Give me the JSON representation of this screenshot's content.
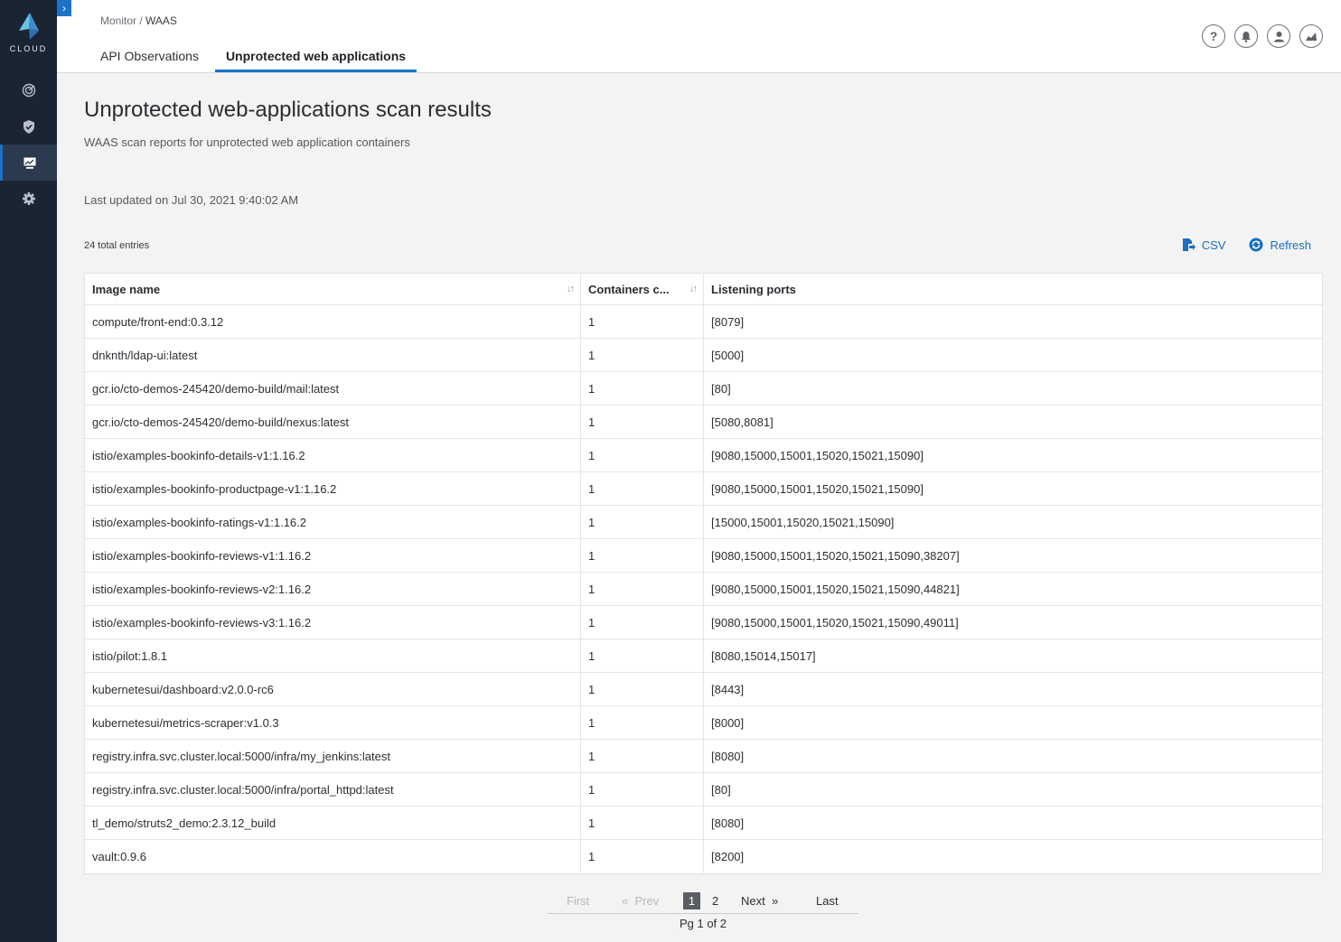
{
  "sidebar": {
    "logo_text": "CLOUD",
    "nav": [
      {
        "icon": "radar-icon"
      },
      {
        "icon": "shield-icon"
      },
      {
        "icon": "monitor-icon",
        "active": true
      },
      {
        "icon": "gear-icon"
      }
    ]
  },
  "header": {
    "breadcrumb_parent": "Monitor",
    "breadcrumb_separator": "/",
    "breadcrumb_current": "WAAS",
    "tabs": [
      {
        "label": "API Observations"
      },
      {
        "label": "Unprotected web applications",
        "active": true
      }
    ],
    "icons": [
      "help-icon",
      "alert-icon",
      "user-icon",
      "analytics-icon"
    ]
  },
  "main": {
    "title": "Unprotected web-applications scan results",
    "subtitle": "WAAS scan reports for unprotected web application containers",
    "last_updated": "Last updated on Jul 30, 2021 9:40:02 AM",
    "total_entries": "24 total entries",
    "csv_label": "CSV",
    "refresh_label": "Refresh"
  },
  "table": {
    "columns": [
      "Image name",
      "Containers c...",
      "Listening ports"
    ],
    "rows": [
      [
        "compute/front-end:0.3.12",
        "1",
        "[8079]"
      ],
      [
        "dnknth/ldap-ui:latest",
        "1",
        "[5000]"
      ],
      [
        "gcr.io/cto-demos-245420/demo-build/mail:latest",
        "1",
        "[80]"
      ],
      [
        "gcr.io/cto-demos-245420/demo-build/nexus:latest",
        "1",
        "[5080,8081]"
      ],
      [
        "istio/examples-bookinfo-details-v1:1.16.2",
        "1",
        "[9080,15000,15001,15020,15021,15090]"
      ],
      [
        "istio/examples-bookinfo-productpage-v1:1.16.2",
        "1",
        "[9080,15000,15001,15020,15021,15090]"
      ],
      [
        "istio/examples-bookinfo-ratings-v1:1.16.2",
        "1",
        "[15000,15001,15020,15021,15090]"
      ],
      [
        "istio/examples-bookinfo-reviews-v1:1.16.2",
        "1",
        "[9080,15000,15001,15020,15021,15090,38207]"
      ],
      [
        "istio/examples-bookinfo-reviews-v2:1.16.2",
        "1",
        "[9080,15000,15001,15020,15021,15090,44821]"
      ],
      [
        "istio/examples-bookinfo-reviews-v3:1.16.2",
        "1",
        "[9080,15000,15001,15020,15021,15090,49011]"
      ],
      [
        "istio/pilot:1.8.1",
        "1",
        "[8080,15014,15017]"
      ],
      [
        "kubernetesui/dashboard:v2.0.0-rc6",
        "1",
        "[8443]"
      ],
      [
        "kubernetesui/metrics-scraper:v1.0.3",
        "1",
        "[8000]"
      ],
      [
        "registry.infra.svc.cluster.local:5000/infra/my_jenkins:latest",
        "1",
        "[8080]"
      ],
      [
        "registry.infra.svc.cluster.local:5000/infra/portal_httpd:latest",
        "1",
        "[80]"
      ],
      [
        "tl_demo/struts2_demo:2.3.12_build",
        "1",
        "[8080]"
      ],
      [
        "vault:0.9.6",
        "1",
        "[8200]"
      ]
    ]
  },
  "pagination": {
    "first": "First",
    "prev": "Prev",
    "page1": "1",
    "page2": "2",
    "next": "Next",
    "last": "Last",
    "info": "Pg 1 of 2"
  },
  "colors": {
    "accent": "#1a73c8",
    "sidebar_bg": "#1b2433",
    "link": "#1a6fbf"
  }
}
